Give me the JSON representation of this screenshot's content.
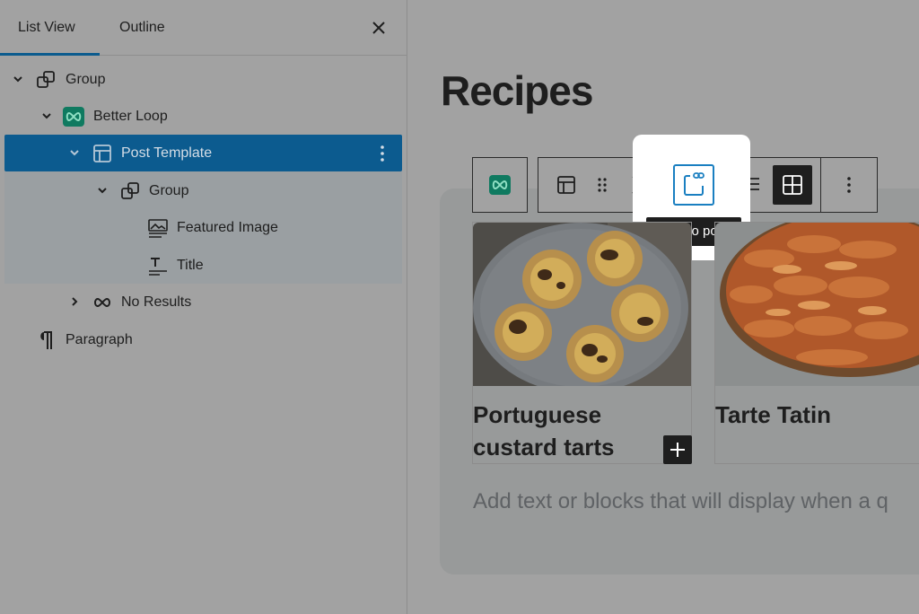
{
  "panel": {
    "tabs": [
      {
        "label": "List View",
        "active": true
      },
      {
        "label": "Outline",
        "active": false
      }
    ],
    "close_icon": "close-icon"
  },
  "tree": [
    {
      "label": "Group",
      "icon": "group-icon",
      "expanded": true,
      "depth": 0
    },
    {
      "label": "Better Loop",
      "icon": "better-loop-icon",
      "expanded": true,
      "depth": 1
    },
    {
      "label": "Post Template",
      "icon": "post-template-icon",
      "expanded": true,
      "depth": 2,
      "selected": true
    },
    {
      "label": "Group",
      "icon": "group-icon",
      "expanded": true,
      "depth": 3
    },
    {
      "label": "Featured Image",
      "icon": "featured-image-icon",
      "depth": 4
    },
    {
      "label": "Title",
      "icon": "title-icon",
      "depth": 4
    },
    {
      "label": "No Results",
      "icon": "no-results-icon",
      "expanded": false,
      "depth": 2
    },
    {
      "label": "Paragraph",
      "icon": "paragraph-icon",
      "depth": 0
    }
  ],
  "editor": {
    "heading": "Recipes",
    "toolbar": {
      "tooltip": "Link to post",
      "buttons": [
        "better-loop-icon",
        "post-template-icon",
        "drag-handle-icon",
        "move-up-down-icon",
        "link-to-post-icon",
        "list-layout-icon",
        "grid-layout-icon",
        "more-options-icon"
      ],
      "active": "grid-layout"
    },
    "cards": [
      {
        "title_line1": "Portuguese",
        "title_line2": "custard tarts"
      },
      {
        "title_line1": "Tarte Tatin",
        "title_line2": ""
      }
    ],
    "no_results_placeholder": "Add text or blocks that will display when a q"
  },
  "colors": {
    "overlay": "#a2a2a2",
    "selection": "#0c5b8f",
    "brand_green": "#0f7a60",
    "accent_blue": "#1a7fc1"
  }
}
